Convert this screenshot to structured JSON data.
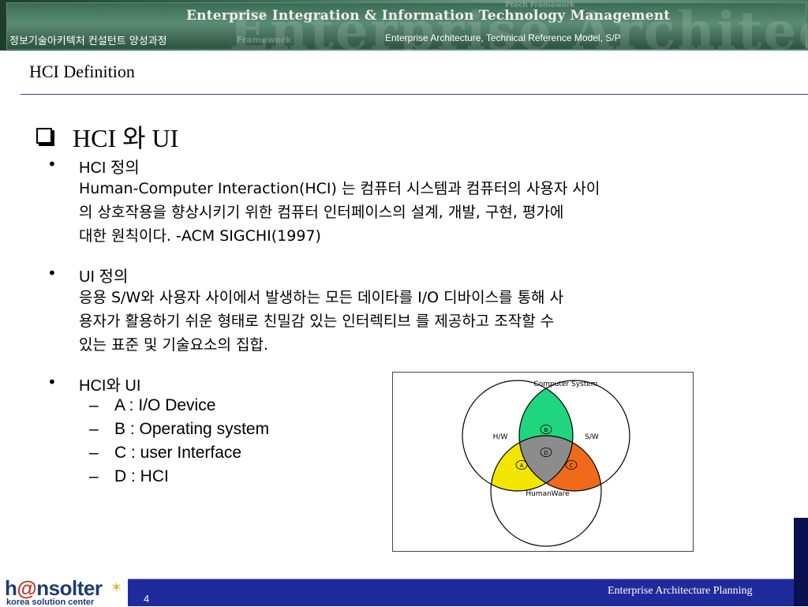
{
  "header": {
    "title": "Enterprise Integration & Information Technology Management",
    "course": "정보기술아키텍처 컨설턴트 양성과정",
    "subtitle": "Enterprise Architecture, Technical Reference Model, S/P",
    "watermark": "Enterprise Architecture Mo",
    "watermark_small": "Framework",
    "watermark_corner": "Ptech Framework"
  },
  "page": {
    "title": "HCI Definition"
  },
  "section": {
    "heading": "HCI 와 UI",
    "items": [
      {
        "label": "HCI 정의",
        "lines": [
          "Human-Computer Interaction(HCI) 는 컴퓨터 시스템과 컴퓨터의 사용자 사이",
          "의 상호작용을 향상시키기 위한 컴퓨터 인터페이스의 설계, 개발, 구현, 평가에",
          "대한 원칙이다.  -ACM SIGCHI(1997)"
        ]
      },
      {
        "label": "UI 정의",
        "lines": [
          "응용 S/W와 사용자 사이에서 발생하는 모든 데이타를  I/O 디바이스를 통해 사",
          "용자가 활용하기 쉬운 형태로 친밀감 있는 인터렉티브 를 제공하고 조작할 수",
          "있는 표준 및 기술요소의 집합."
        ]
      },
      {
        "label": "HCI와 UI",
        "sub": [
          "A : I/O Device",
          "B : Operating system",
          "C : user Interface",
          "D : HCI"
        ]
      }
    ]
  },
  "diagram": {
    "title": "Computer System",
    "circles": {
      "left": "H/W",
      "right": "S/W",
      "bottom": "HumanWare"
    },
    "markers": {
      "a": "A",
      "b": "B",
      "c": "C",
      "d": "D"
    },
    "colors": {
      "b_region": "#1fd67e",
      "a_region": "#f2e600",
      "c_region": "#f06a1c",
      "d_region": "#8c8c8c"
    }
  },
  "footer": {
    "logo_main_1": "h",
    "logo_at": "@",
    "logo_main_2": "nsolter",
    "logo_sub": "korea solution center",
    "page_number": "4",
    "text": "Enterprise Architecture Planning"
  }
}
